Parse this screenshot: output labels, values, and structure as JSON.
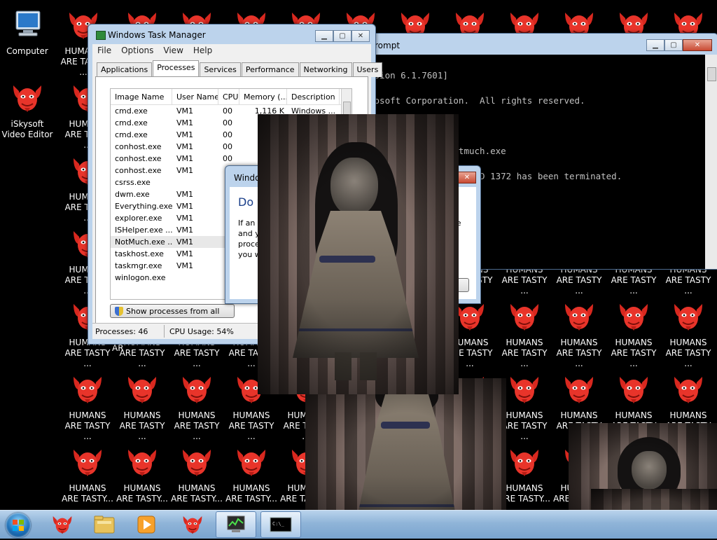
{
  "desktop": {
    "computer_label": "Computer",
    "video_editor_label": "iSkysoft Video Editor",
    "virus_label": "HUMANS ARE TASTY ...",
    "virus_label_line1": "HUMANS",
    "virus_label_line2": "ARE TASTY ...",
    "virus_label_line2_alt": "ARE TASTY...",
    "partial_ar": "AR"
  },
  "task_manager": {
    "title": "Windows Task Manager",
    "menu": [
      "File",
      "Options",
      "View",
      "Help"
    ],
    "tabs": [
      "Applications",
      "Processes",
      "Services",
      "Performance",
      "Networking",
      "Users"
    ],
    "selected_tab": "Processes",
    "columns": [
      "Image Name",
      "User Name",
      "CPU",
      "Memory (...",
      "Description"
    ],
    "rows": [
      [
        "cmd.exe",
        "VM1",
        "00",
        "1,116 K",
        "Windows ..."
      ],
      [
        "cmd.exe",
        "VM1",
        "00",
        "",
        ""
      ],
      [
        "cmd.exe",
        "VM1",
        "00",
        "",
        ""
      ],
      [
        "conhost.exe",
        "VM1",
        "00",
        "",
        ""
      ],
      [
        "conhost.exe",
        "VM1",
        "00",
        "",
        ""
      ],
      [
        "conhost.exe",
        "VM1",
        "",
        "",
        ""
      ],
      [
        "csrss.exe",
        "",
        "",
        "",
        ""
      ],
      [
        "dwm.exe",
        "VM1",
        "",
        "",
        ""
      ],
      [
        "Everything.exe",
        "VM1",
        "",
        "",
        ""
      ],
      [
        "explorer.exe",
        "VM1",
        "",
        "",
        ""
      ],
      [
        "ISHelper.exe ...",
        "VM1",
        "",
        "",
        ""
      ],
      [
        "NotMuch.exe ...",
        "VM1",
        "",
        "",
        ""
      ],
      [
        "taskhost.exe",
        "VM1",
        "",
        "",
        ""
      ],
      [
        "taskmgr.exe",
        "VM1",
        "",
        "",
        ""
      ],
      [
        "winlogon.exe",
        "",
        "",
        "",
        ""
      ]
    ],
    "highlighted_row": 11,
    "show_all_button": "Show processes from all user",
    "status_processes": "Processes: 46",
    "status_cpu": "CPU Usage: 54%"
  },
  "command_prompt": {
    "title": "rompt",
    "lines": [
      "rsion 6.1.7601]",
      "rosoft Corporation.  All rights reserved.",
      "",
      "askkill /f /im notmuch.exe",
      "\"NotMuch.exe\" with PID 1372 has been terminated."
    ]
  },
  "dialog": {
    "title": "Windo",
    "heading": "Do y",
    "text_lines": [
      "If an o",
      "and y",
      "proce",
      "you w"
    ],
    "text_right": "se"
  },
  "colors": {
    "taskbar": "#8fb4d8",
    "desktop": "#000000",
    "virus_icon_red": "#e8342a",
    "highlight_row": "#e8e8e8"
  }
}
